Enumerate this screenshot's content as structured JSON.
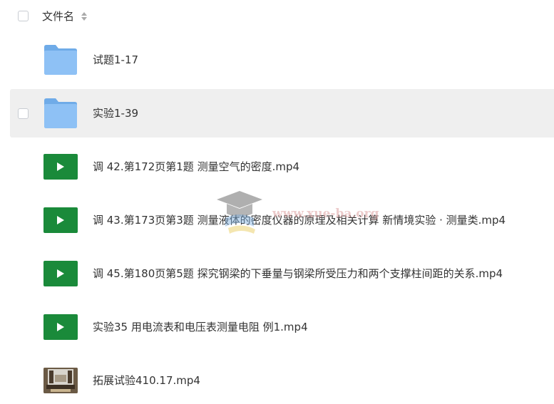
{
  "header": {
    "column_label": "文件名"
  },
  "files": [
    {
      "name": "试题1-17",
      "type": "folder",
      "icon": "folder-icon"
    },
    {
      "name": "实验1-39",
      "type": "folder",
      "icon": "folder-icon"
    },
    {
      "name": "调 42.第172页第1题 测量空气的密度.mp4",
      "type": "video",
      "icon": "play-icon"
    },
    {
      "name": "调 43.第173页第3题 测量液体的密度仪器的原理及相关计算 新情境实验 · 测量类.mp4",
      "type": "video",
      "icon": "play-icon"
    },
    {
      "name": "调 45.第180页第5题 探究钢梁的下垂量与钢梁所受压力和两个支撑柱间距的关系.mp4",
      "type": "video",
      "icon": "play-icon"
    },
    {
      "name": "实验35 用电流表和电压表测量电阻 例1.mp4",
      "type": "video",
      "icon": "play-icon"
    },
    {
      "name": "拓展试验410.17.mp4",
      "type": "video-thumbnail",
      "icon": "video-thumbnail"
    }
  ],
  "watermark": {
    "text": "www.xue-ba.org"
  },
  "colors": {
    "folder": "#8ec1f5",
    "video": "#1a8a3a",
    "hover_row": "#efefef"
  }
}
